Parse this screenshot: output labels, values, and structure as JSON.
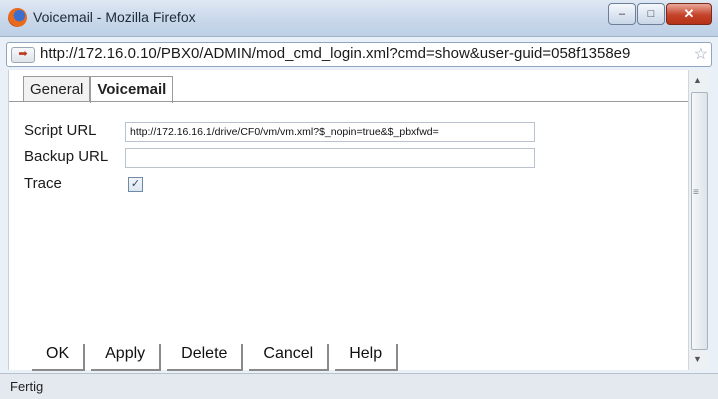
{
  "window": {
    "title": "Voicemail - Mozilla Firefox",
    "buttons": {
      "minimize": "–",
      "maximize": "□",
      "close": "✕"
    }
  },
  "address_bar": {
    "url": "http://172.16.0.10/PBX0/ADMIN/mod_cmd_login.xml?cmd=show&user-guid=058f1358e9",
    "site_icon": "arrow-icon",
    "star_icon": "☆"
  },
  "tabs": [
    {
      "label": "General",
      "active": false
    },
    {
      "label": "Voicemail",
      "active": true
    }
  ],
  "form": {
    "script_url": {
      "label": "Script URL",
      "value": "http://172.16.16.1/drive/CF0/vm/vm.xml?$_nopin=true&$_pbxfwd="
    },
    "backup_url": {
      "label": "Backup URL",
      "value": ""
    },
    "trace": {
      "label": "Trace",
      "checked": true,
      "mark": "✓"
    }
  },
  "actions": {
    "ok": "OK",
    "apply": "Apply",
    "delete": "Delete",
    "cancel": "Cancel",
    "help": "Help"
  },
  "status_bar": {
    "text": "Fertig"
  }
}
